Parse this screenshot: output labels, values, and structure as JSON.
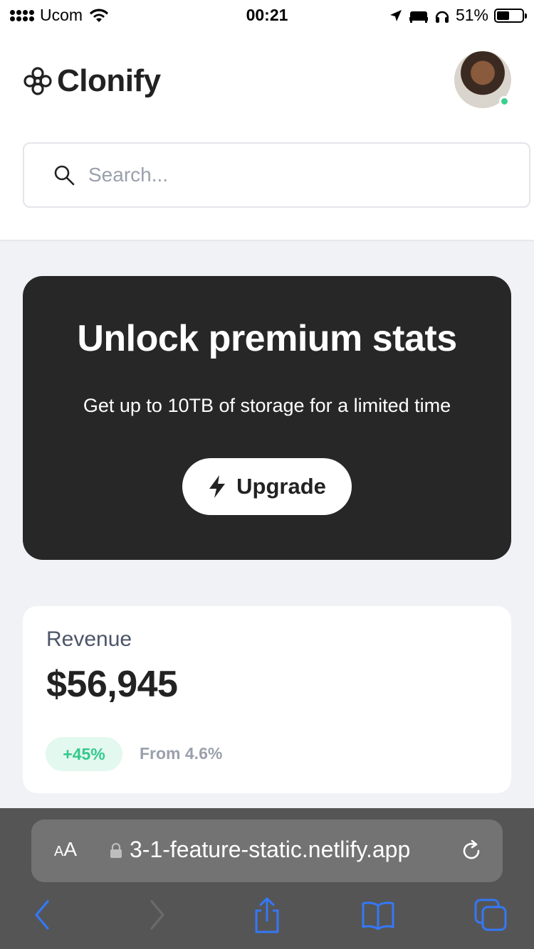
{
  "status_bar": {
    "carrier": "Ucom",
    "time": "00:21",
    "battery_percent": "51%",
    "battery_level": 0.51
  },
  "header": {
    "logo_text": "Clonify",
    "search_placeholder": "Search...",
    "avatar_online": true
  },
  "promo": {
    "title": "Unlock premium stats",
    "subtitle": "Get up to 10TB of storage for a limited time",
    "button_label": "Upgrade"
  },
  "revenue_card": {
    "label": "Revenue",
    "value": "$56,945",
    "change_badge": "+45%",
    "comparison": "From 4.6%"
  },
  "browser": {
    "text_size_label_small": "A",
    "text_size_label_large": "A",
    "url": "3-1-feature-static.netlify.app"
  },
  "colors": {
    "accent_green": "#34c98b",
    "promo_bg": "#272727",
    "page_bg": "#f1f2f6",
    "safari_blue": "#3478f6"
  }
}
